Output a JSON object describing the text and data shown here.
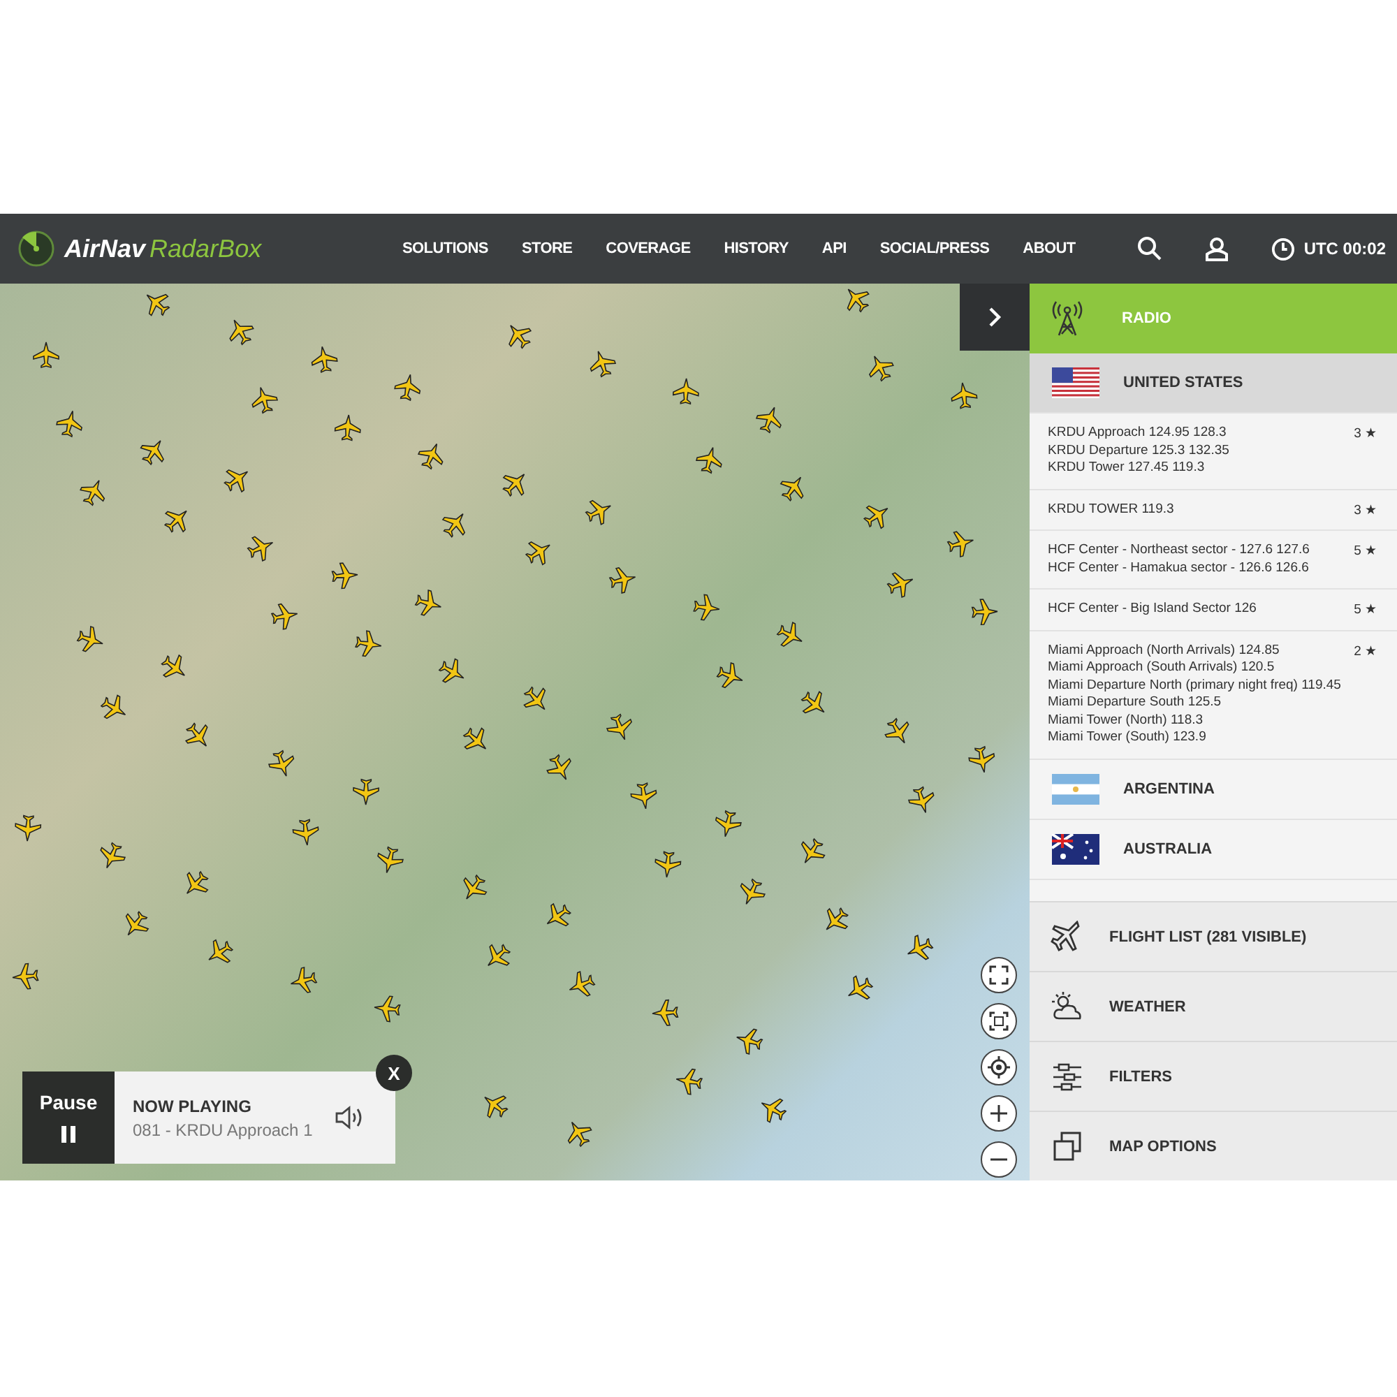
{
  "header": {
    "logo_main": "AirNav",
    "logo_accent": "RadarBox",
    "nav": [
      "SOLUTIONS",
      "STORE",
      "COVERAGE",
      "HISTORY",
      "API",
      "SOCIAL/PRESS",
      "ABOUT"
    ],
    "clock": "UTC 00:02"
  },
  "map": {
    "controls": [
      {
        "kind": "fullscreen"
      },
      {
        "kind": "expand"
      },
      {
        "kind": "locate"
      },
      {
        "kind": "zoom-in"
      },
      {
        "kind": "zoom-out"
      }
    ]
  },
  "radio": {
    "title": "RADIO",
    "countries": [
      {
        "name": "UNITED STATES",
        "expanded": true,
        "stations": [
          {
            "lines": [
              "KRDU Approach 124.95 128.3",
              "KRDU Departure 125.3 132.35",
              "KRDU Tower 127.45 119.3"
            ],
            "rating": "3 ★"
          },
          {
            "lines": [
              "KRDU TOWER 119.3"
            ],
            "rating": "3 ★"
          },
          {
            "lines": [
              "HCF Center - Northeast sector - 127.6 127.6",
              "HCF Center - Hamakua sector - 126.6 126.6"
            ],
            "rating": "5 ★"
          },
          {
            "lines": [
              "HCF Center - Big Island Sector 126"
            ],
            "rating": "5 ★"
          },
          {
            "lines": [
              "Miami Approach (North Arrivals) 124.85",
              "Miami Approach (South Arrivals) 120.5",
              "Miami Departure North (primary night freq) 119.45",
              "Miami Departure South 125.5",
              "Miami Tower (North) 118.3",
              "Miami Tower (South) 123.9"
            ],
            "rating": "2 ★"
          }
        ]
      },
      {
        "name": "ARGENTINA",
        "expanded": false
      },
      {
        "name": "AUSTRALIA",
        "expanded": false
      }
    ]
  },
  "menu": [
    {
      "label": "FLIGHT LIST (281 VISIBLE)"
    },
    {
      "label": "WEATHER"
    },
    {
      "label": "FILTERS"
    },
    {
      "label": "MAP OPTIONS"
    }
  ],
  "player": {
    "button": "Pause",
    "title": "NOW PLAYING",
    "track": "081 - KRDU Approach 1",
    "close": "X"
  }
}
